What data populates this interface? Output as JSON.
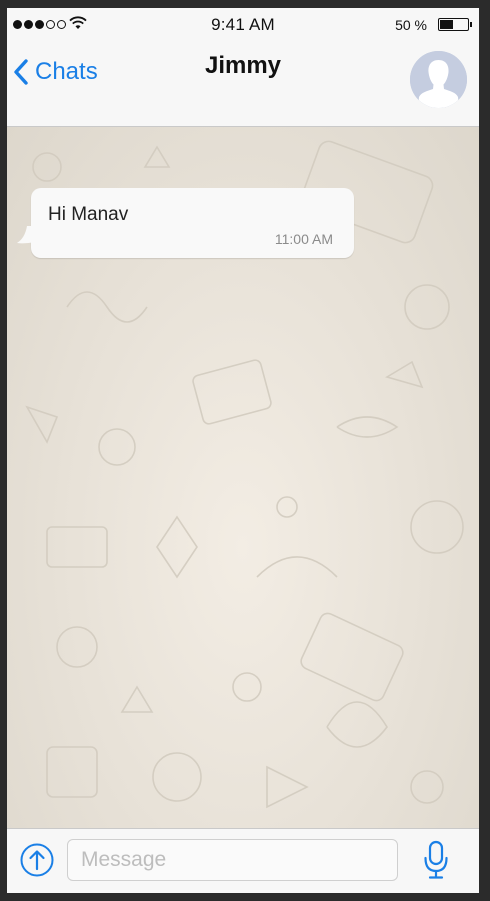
{
  "status_bar": {
    "signal": {
      "filled": 3,
      "empty": 2
    },
    "time": "9:41 AM",
    "battery_label": "50 %",
    "battery_level": 0.5
  },
  "nav": {
    "back_label": "Chats",
    "title": "Jimmy",
    "avatar_icon": "profile-placeholder-icon"
  },
  "messages": [
    {
      "text": "Hi Manav",
      "time": "11:00 AM",
      "direction": "incoming"
    }
  ],
  "input": {
    "placeholder": "Message",
    "value": "",
    "attach_icon": "upload-arrow-icon",
    "mic_icon": "microphone-icon"
  },
  "colors": {
    "accent": "#1a7fe6",
    "bubble": "#f9f9f9",
    "chat_background": "#e7e1d7"
  }
}
